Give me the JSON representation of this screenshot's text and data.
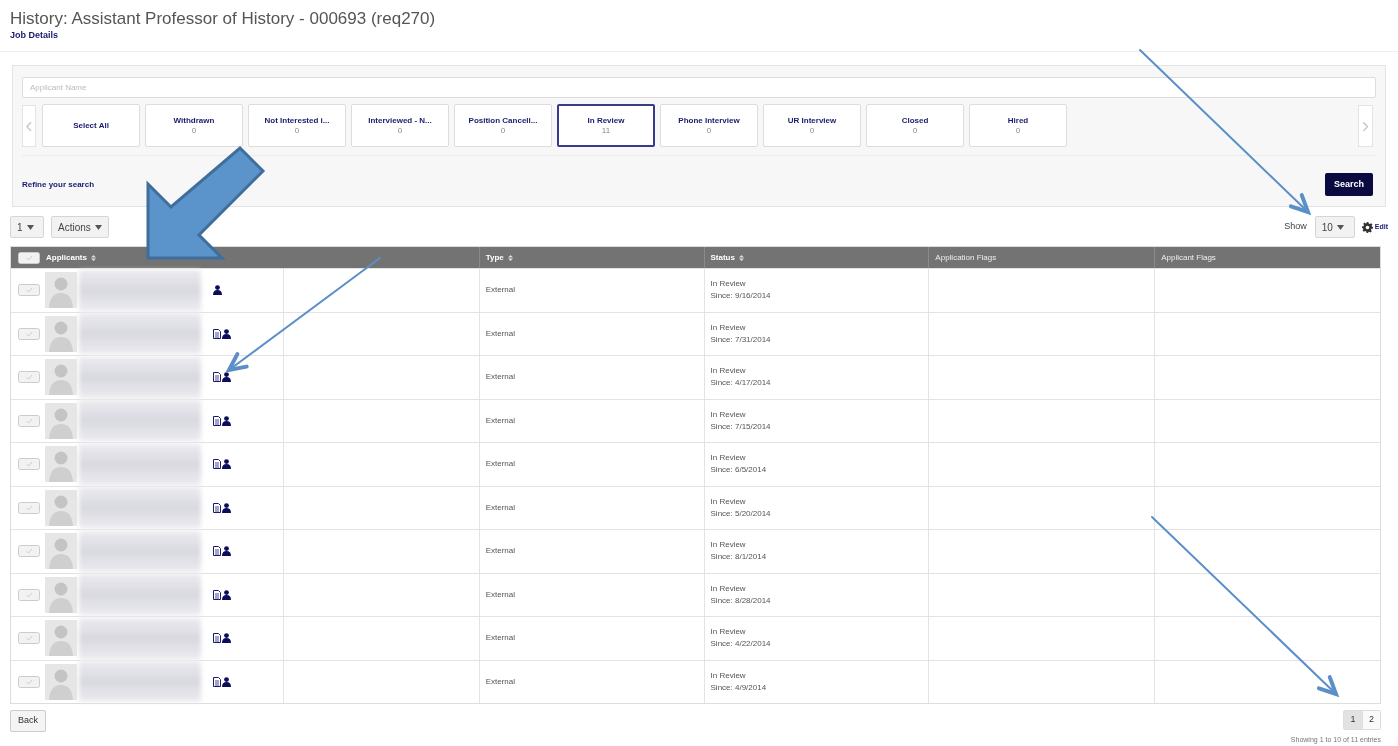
{
  "header": {
    "title": "History: Assistant Professor of History - 000693 (req270)",
    "link": "Job Details"
  },
  "filter": {
    "search": {
      "placeholder": "Applicant Name"
    },
    "prev": "‹",
    "next": "›",
    "statuses": [
      {
        "label": "Select All",
        "selected": false
      },
      {
        "label": "Withdrawn",
        "count": "0",
        "selected": false
      },
      {
        "label": "Not Interested i...",
        "count": "0",
        "selected": false
      },
      {
        "label": "Interviewed - N...",
        "count": "0",
        "selected": false
      },
      {
        "label": "Position Cancell...",
        "count": "0",
        "selected": false
      },
      {
        "label": "In Review",
        "count": "11",
        "selected": true
      },
      {
        "label": "Phone Interview",
        "count": "0",
        "selected": false
      },
      {
        "label": "UR Interview",
        "count": "0",
        "selected": false
      },
      {
        "label": "Closed",
        "count": "0",
        "selected": false
      },
      {
        "label": "Hired",
        "count": "0",
        "selected": false
      }
    ],
    "refine_link": "Refine your search",
    "search_button": "Search"
  },
  "toolbar": {
    "page_select": "1",
    "actions": "Actions",
    "show_label": "Show",
    "show_value": "10",
    "edit": "Edit"
  },
  "table": {
    "select_all_checked": false,
    "columns": [
      {
        "label": "Applicants",
        "sortable": true
      },
      {
        "label": "Type",
        "sortable": true
      },
      {
        "label": "Status",
        "sortable": true
      },
      {
        "label": "Application Flags",
        "sortable": false
      },
      {
        "label": "Applicant Flags",
        "sortable": false
      }
    ],
    "rows": [
      {
        "checked": false,
        "has_document": false,
        "type": "External",
        "status": "In Review",
        "since": "Since: 9/16/2014"
      },
      {
        "checked": false,
        "has_document": true,
        "type": "External",
        "status": "In Review",
        "since": "Since: 7/31/2014"
      },
      {
        "checked": false,
        "has_document": true,
        "type": "External",
        "status": "In Review",
        "since": "Since: 4/17/2014"
      },
      {
        "checked": false,
        "has_document": true,
        "type": "External",
        "status": "In Review",
        "since": "Since: 7/15/2014"
      },
      {
        "checked": false,
        "has_document": true,
        "type": "External",
        "status": "In Review",
        "since": "Since: 6/5/2014"
      },
      {
        "checked": false,
        "has_document": true,
        "type": "External",
        "status": "In Review",
        "since": "Since: 5/20/2014"
      },
      {
        "checked": false,
        "has_document": true,
        "type": "External",
        "status": "In Review",
        "since": "Since: 8/1/2014"
      },
      {
        "checked": false,
        "has_document": true,
        "type": "External",
        "status": "In Review",
        "since": "Since: 8/28/2014"
      },
      {
        "checked": false,
        "has_document": true,
        "type": "External",
        "status": "In Review",
        "since": "Since: 4/22/2014"
      },
      {
        "checked": false,
        "has_document": true,
        "type": "External",
        "status": "In Review",
        "since": "Since: 4/9/2014"
      }
    ]
  },
  "footer": {
    "back": "Back",
    "pages": [
      {
        "label": "1",
        "selected": true
      },
      {
        "label": "2",
        "selected": false
      }
    ],
    "summary": "Showing 1 to 10 of 11 entries"
  }
}
